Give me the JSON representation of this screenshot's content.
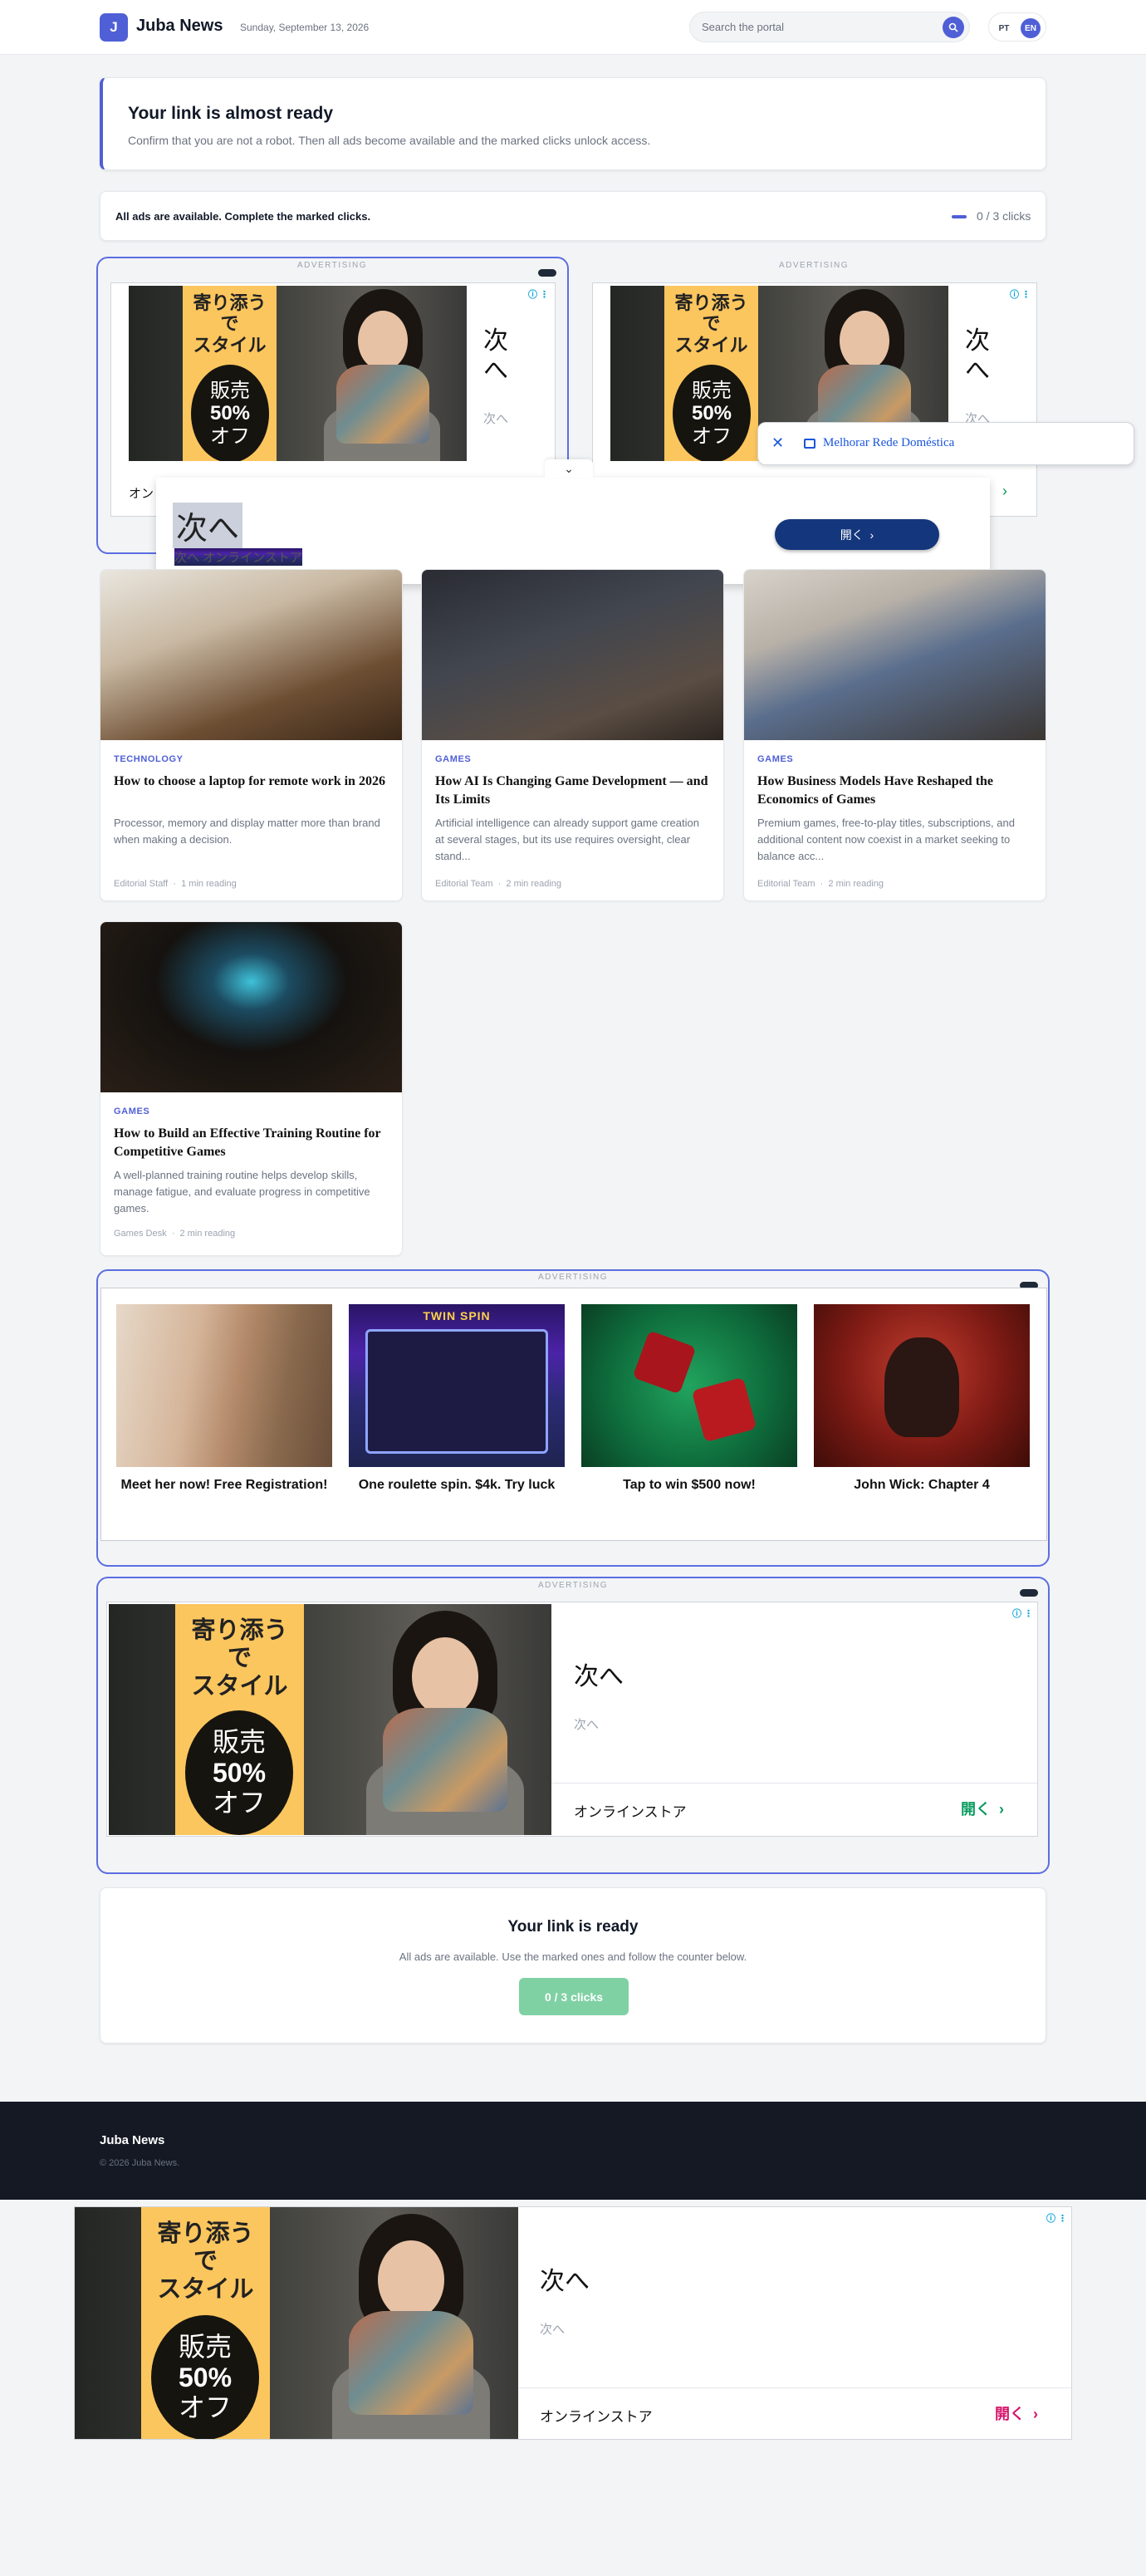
{
  "header": {
    "logo_letter": "J",
    "brand": "Juba News",
    "date": "Sunday, September 13, 2026",
    "search_placeholder": "Search the portal",
    "lang_pt": "PT",
    "lang_en": "EN"
  },
  "notice": {
    "title": "Your link is almost ready",
    "text": "Confirm that you are not a robot. Then all ads become available and the marked clicks unlock access."
  },
  "progress": {
    "text": "All ads are available. Complete the marked clicks.",
    "counter": "0 / 3 clicks",
    "done": 0,
    "total": 3
  },
  "ads": {
    "label": "ADVERTISING",
    "jp_style": "寄り添う\nで\nスタイル",
    "jp_sale": "販売",
    "jp_percent": "50%",
    "jp_off": "オフ",
    "jp_next": "次へ",
    "jp_next_small": "次へ",
    "jp_store": "オンラインストア",
    "jp_open": "開く",
    "jp_store_short": "オン",
    "info_icon": "info-icon"
  },
  "float_nav": {
    "label": "Melhorar Rede Doméstica"
  },
  "dropdown_ad": {
    "title": "次へ",
    "subtitle": "次へ オンラインストア",
    "button": "開く"
  },
  "articles": [
    {
      "category": "TECHNOLOGY",
      "title": "How to choose a laptop for remote work in 2026",
      "excerpt": "Processor, memory and display matter more than brand when making a decision.",
      "author": "Editorial Staff",
      "reading": "1 min reading"
    },
    {
      "category": "GAMES",
      "title": "How AI Is Changing Game Development — and Its Limits",
      "excerpt": "Artificial intelligence can already support game creation at several stages, but its use requires oversight, clear stand...",
      "author": "Editorial Team",
      "reading": "2 min reading"
    },
    {
      "category": "GAMES",
      "title": "How Business Models Have Reshaped the Economics of Games",
      "excerpt": "Premium games, free-to-play titles, subscriptions, and additional content now coexist in a market seeking to balance acc...",
      "author": "Editorial Team",
      "reading": "2 min reading"
    },
    {
      "category": "GAMES",
      "title": "How to Build an Effective Training Routine for Competitive Games",
      "excerpt": "A well-planned training routine helps develop skills, manage fatigue, and evaluate progress in competitive games.",
      "author": "Games Desk",
      "reading": "2 min reading"
    }
  ],
  "promos": [
    {
      "title": "Meet her now! Free Registration!"
    },
    {
      "title": "One roulette spin. $4k. Try luck"
    },
    {
      "title": "Tap to win $500 now!"
    },
    {
      "title": "John Wick: Chapter 4"
    }
  ],
  "promo_misc": {
    "slot_logo": "TWIN SPIN"
  },
  "ready": {
    "title": "Your link is ready",
    "text": "All ads are available. Use the marked ones and follow the counter below.",
    "button": "0 / 3 clicks"
  },
  "footer": {
    "brand": "Juba News",
    "copyright": "© 2026 Juba News."
  },
  "colors": {
    "accent": "#4f5fd6",
    "dark_footer": "#141924",
    "ad_green": "#0a9b5f",
    "ad_pink": "#d5136b",
    "ready_button": "#7fd1a4",
    "outline_blue": "#5b6ee1"
  }
}
